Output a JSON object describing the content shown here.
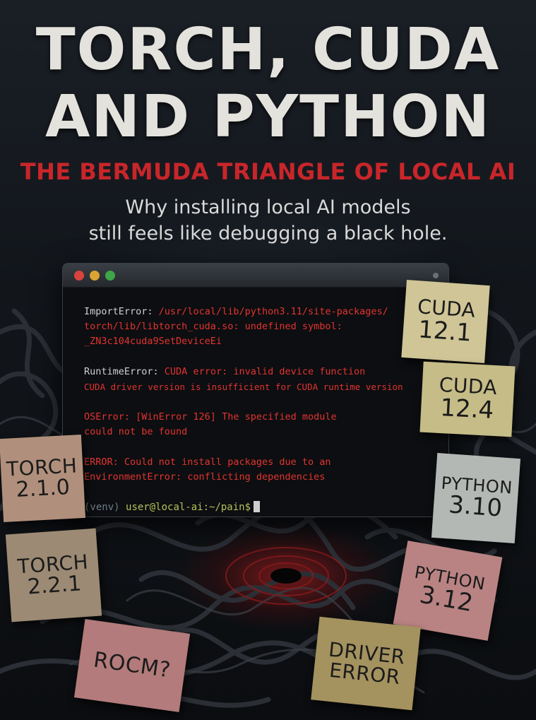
{
  "title": {
    "line1": "TORCH, CUDA",
    "line2": "AND PYTHON"
  },
  "subtitle": "THE BERMUDA TRIANGLE OF LOCAL AI",
  "tagline": {
    "line1": "Why installing local AI models",
    "line2": "still feels like debugging a black hole."
  },
  "terminal": {
    "errors": [
      {
        "type": "ImportError:",
        "lines": [
          " /usr/local/lib/python3.11/site-packages/",
          "torch/lib/libtorch_cuda.so: undefined symbol:",
          "_ZN3c104cuda9SetDeviceEi"
        ]
      },
      {
        "type": "RuntimeError:",
        "lines": [
          " CUDA error: invalid device function",
          "CUDA driver version is insufficient for CUDA runtime version"
        ]
      },
      {
        "type": "",
        "lines": [
          "OSError: [WinError 126] The specified module",
          "could not be found"
        ]
      },
      {
        "type": "",
        "lines": [
          "ERROR: Could not install packages due to an",
          "EnvironmentError: conflicting dependencies"
        ]
      }
    ],
    "prompt": {
      "venv": "(venv) ",
      "user": "user@local-ai:~/pain$"
    }
  },
  "notes": {
    "cuda_121": {
      "line1": "CUDA",
      "line2": "12.1"
    },
    "cuda_124": {
      "line1": "CUDA",
      "line2": "12.4"
    },
    "python_310": {
      "line1": "PYTHON",
      "line2": "3.10"
    },
    "python_312": {
      "line1": "PYTHON",
      "line2": "3.12"
    },
    "torch_210": {
      "line1": "TORCH",
      "line2": "2.1.0"
    },
    "torch_221": {
      "line1": "TORCH",
      "line2": "2.2.1"
    },
    "rocm": {
      "line1": "ROCM?"
    },
    "driver_error": {
      "line1": "DRIVER",
      "line2": "ERROR"
    }
  },
  "colors": {
    "accent_red": "#c8262a",
    "error_red": "#e3342f",
    "title_white": "#e4e2dc"
  }
}
